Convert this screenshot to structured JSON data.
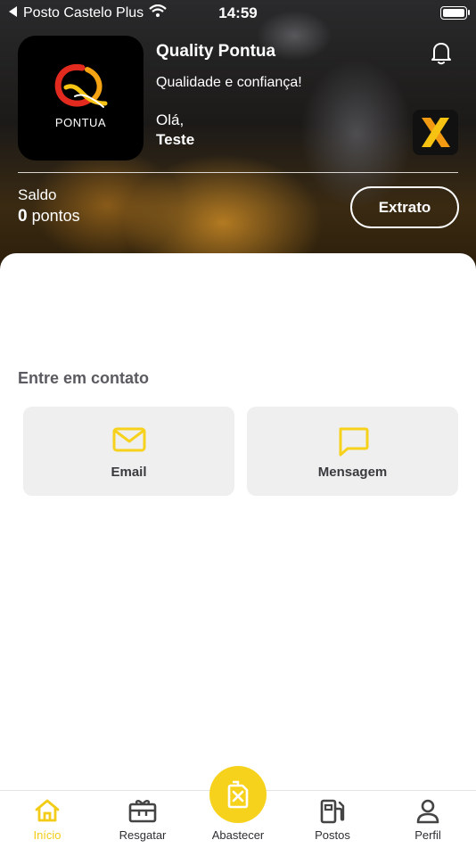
{
  "status_bar": {
    "carrier": "Posto Castelo Plus",
    "time": "14:59"
  },
  "header": {
    "logo_text": "PONTUA",
    "brand_title": "Quality Pontua",
    "brand_subtitle": "Qualidade e confiança!",
    "greeting": "Olá,",
    "user_name": "Teste",
    "balance_label": "Saldo",
    "balance_value": "0",
    "balance_unit": "pontos",
    "statement_button": "Extrato"
  },
  "contact": {
    "title": "Entre em contato",
    "cards": [
      {
        "label": "Email",
        "icon": "mail-icon"
      },
      {
        "label": "Mensagem",
        "icon": "message-icon"
      }
    ]
  },
  "tabbar": {
    "items": [
      {
        "label": "Início",
        "icon": "home-icon",
        "active": true
      },
      {
        "label": "Resgatar",
        "icon": "gift-card-icon",
        "active": false
      },
      {
        "label": "Abastecer",
        "icon": "fuel-can-icon",
        "active": false
      },
      {
        "label": "Postos",
        "icon": "gas-station-icon",
        "active": false
      },
      {
        "label": "Perfil",
        "icon": "user-icon",
        "active": false
      }
    ]
  },
  "colors": {
    "accent": "#F7D21C",
    "card_bg": "#EFEFEF",
    "active_tab": "#F2CC16"
  }
}
